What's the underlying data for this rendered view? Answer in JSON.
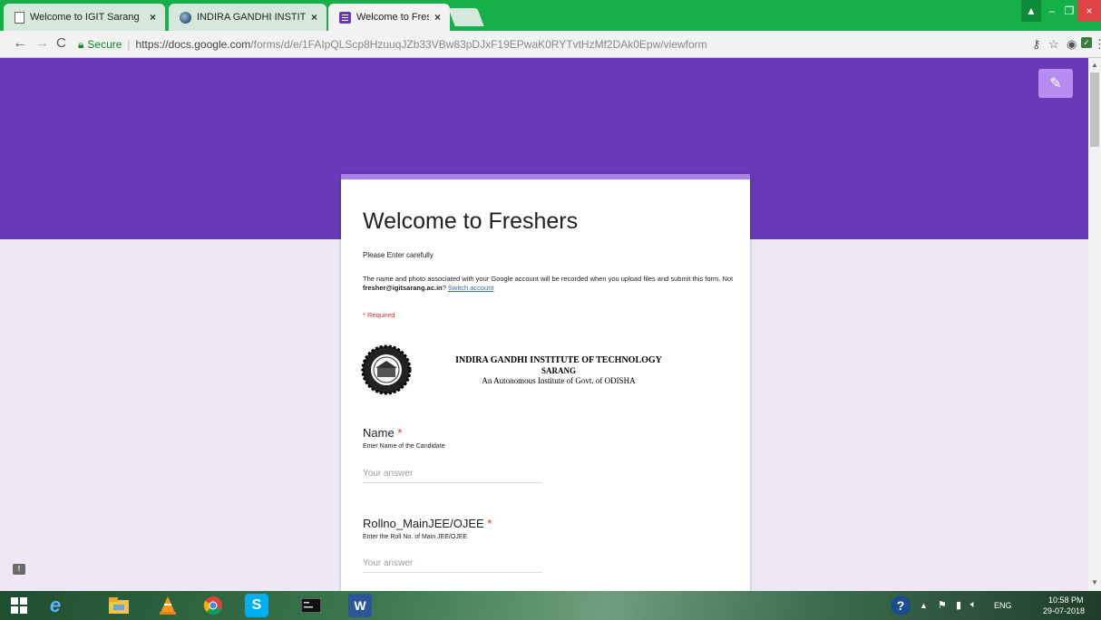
{
  "browser": {
    "tabs": [
      {
        "title": "Welcome to IGIT Sarang",
        "close": "×",
        "favicon": "document-icon"
      },
      {
        "title": "INDIRA GANDHI INSTITU",
        "close": "×",
        "favicon": "globe-icon"
      },
      {
        "title": "Welcome to Freshers",
        "close": "×",
        "favicon": "forms-icon"
      }
    ],
    "secure_label": "Secure",
    "url_host": "https://docs.google.com",
    "url_path": "/forms/d/e/1FAIpQLScp8HzuuqJZb33VBw83pDJxF19EPwaK0RYTvtHzMf2DAk0Epw/viewform",
    "window_controls": {
      "user": "▲",
      "minimize": "–",
      "restore": "❐",
      "close": "×"
    }
  },
  "form": {
    "title": "Welcome to Freshers",
    "description": "Please Enter carefully",
    "account_notice_pre": "The name and photo associated with your Google account will be recorded when you upload files and submit this form. Not ",
    "account_email": "fresher@igitsarang.ac.in",
    "account_notice_q": "? ",
    "switch_account": "Switch account",
    "required_note": "* Required",
    "institute": {
      "name": "INDIRA GANDHI INSTITUTE OF TECHNOLOGY",
      "city": "SARANG",
      "subtitle": "An Autonomous Institute of Govt. of ODISHA"
    },
    "questions": [
      {
        "label": "Name",
        "required_mark": "*",
        "help": "Enter Name of the Candidate",
        "placeholder": "Your answer"
      },
      {
        "label": "Rollno_MainJEE/OJEE",
        "required_mark": "*",
        "help": "Enter the Roll No. of Main JEE/OJEE",
        "placeholder": "Your answer"
      }
    ]
  },
  "taskbar": {
    "time": "10:58 PM",
    "date": "29-07-2018",
    "language": "ENG"
  },
  "colors": {
    "brand": "#673ab7",
    "accent": "#a983e8",
    "required": "#d93025",
    "chrome_frame": "#15b04a"
  }
}
